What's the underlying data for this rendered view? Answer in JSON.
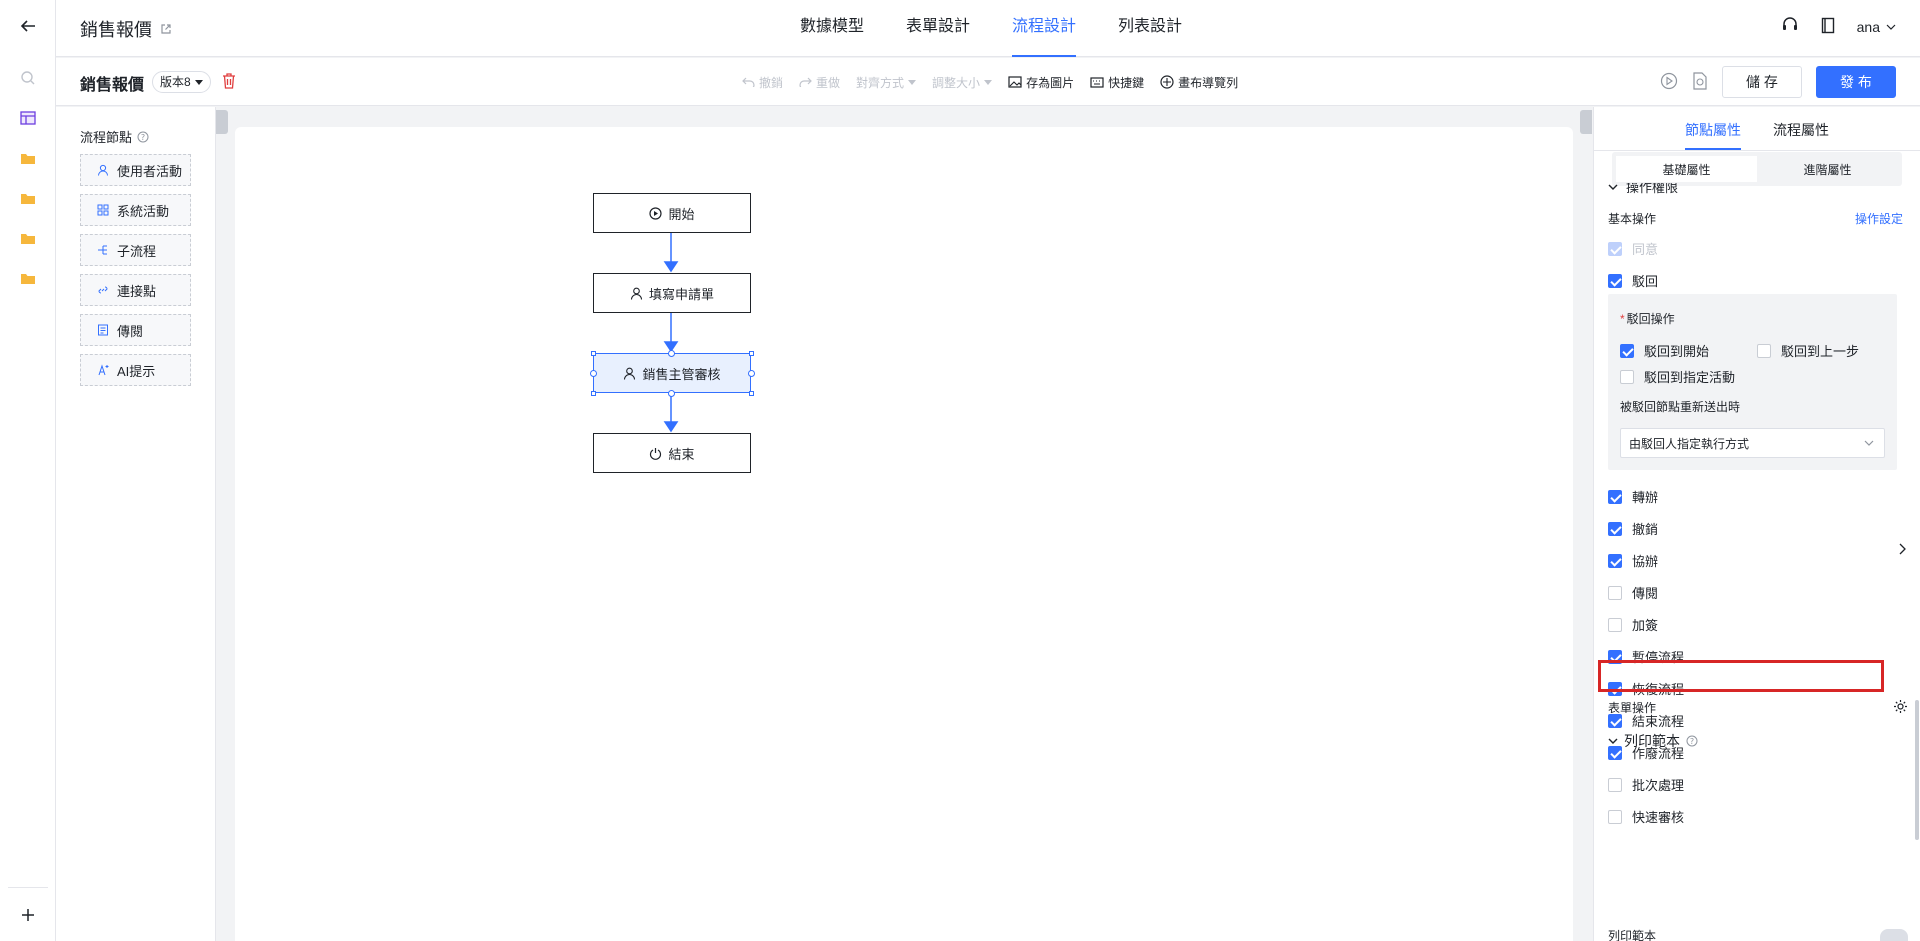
{
  "header": {
    "app_title": "銷售報價",
    "tabs": [
      "數據模型",
      "表單設計",
      "流程設計",
      "列表設計"
    ],
    "active_tab": "流程設計",
    "user": "ana"
  },
  "toolbar": {
    "process_name": "銷售報價",
    "version": "版本8",
    "tools": {
      "undo": "撤銷",
      "redo": "重做",
      "align": "對齊方式",
      "resize": "調整大小",
      "save_image": "存為圖片",
      "shortcuts": "快捷鍵",
      "canvas_nav": "畫布導覽列"
    },
    "save_label": "儲 存",
    "publish_label": "發 布"
  },
  "node_panel": {
    "title": "流程節點",
    "items": [
      "使用者活動",
      "系統活動",
      "子流程",
      "連接點",
      "傳閱",
      "AI提示"
    ]
  },
  "flow": {
    "nodes": [
      "開始",
      "填寫申請單",
      "銷售主管審核",
      "結束"
    ],
    "selected": "銷售主管審核"
  },
  "properties": {
    "tabs": [
      "節點屬性",
      "流程屬性"
    ],
    "active_tab": "節點屬性",
    "segments": [
      "基礎屬性",
      "進階屬性"
    ],
    "section_partial": "操作權限",
    "basic_ops_label": "基本操作",
    "op_settings_link": "操作設定",
    "agree": "同意",
    "reject": "駁回",
    "reject_ops_label": "駁回操作",
    "reject_to_start": "駁回到開始",
    "reject_to_prev": "駁回到上一步",
    "reject_to_activity": "駁回到指定活動",
    "resubmit_label": "被駁回節點重新送出時",
    "resubmit_value": "由駁回人指定執行方式",
    "ops": [
      {
        "label": "轉辦",
        "checked": true
      },
      {
        "label": "撤銷",
        "checked": true
      },
      {
        "label": "協辦",
        "checked": true
      },
      {
        "label": "傳閱",
        "checked": false
      },
      {
        "label": "加簽",
        "checked": false
      },
      {
        "label": "暫停流程",
        "checked": true
      },
      {
        "label": "恢復流程",
        "checked": true
      },
      {
        "label": "結束流程",
        "checked": true
      },
      {
        "label": "作廢流程",
        "checked": true
      },
      {
        "label": "批次處理",
        "checked": false
      },
      {
        "label": "快速審核",
        "checked": false
      }
    ],
    "form_ops_label": "表單操作",
    "print_template_section": "列印範本",
    "print_template_label": "列印範本"
  }
}
